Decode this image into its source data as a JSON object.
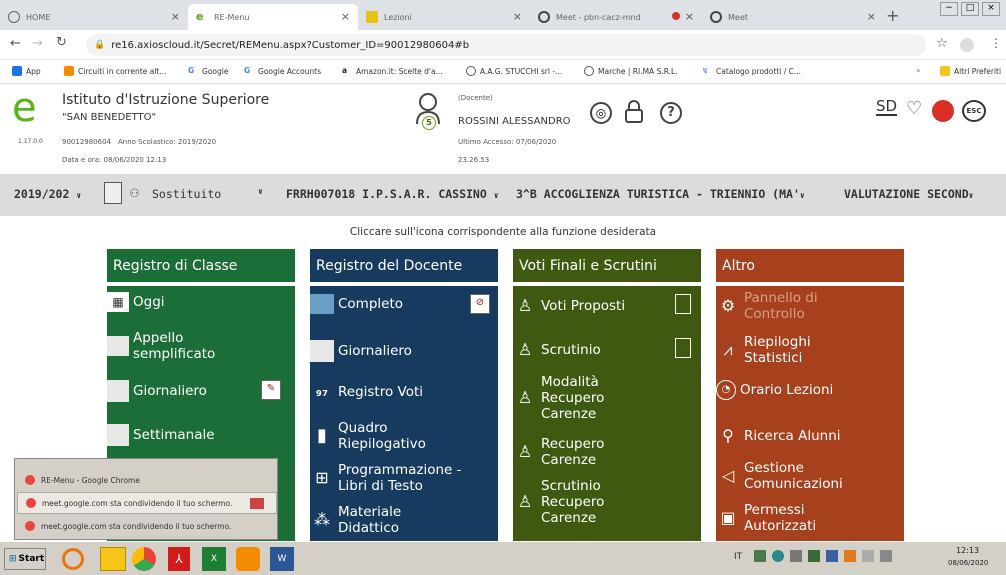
{
  "browser": {
    "tabs": [
      {
        "label": "HOME"
      },
      {
        "label": "RE-Menu"
      },
      {
        "label": "Lezioni"
      },
      {
        "label": "Meet - pbn-cacz-mnd"
      },
      {
        "label": "Meet"
      }
    ],
    "url": "re16.axioscloud.it/Secret/REMenu.aspx?Customer_ID=90012980604#b",
    "bookmarks": [
      {
        "label": "App"
      },
      {
        "label": "Circuiti in corrente alt..."
      },
      {
        "label": "Google"
      },
      {
        "label": "Google Accounts"
      },
      {
        "label": "Amazon.it: Scelte d'a..."
      },
      {
        "label": "A.A.G. STUCCHI srl -..."
      },
      {
        "label": "Marche | RI.MA S.R.L."
      },
      {
        "label": "Catalogo prodotti / C..."
      },
      {
        "label": "Altri Preferiti"
      }
    ],
    "more_bookmarks": "»"
  },
  "header": {
    "school_line1": "Istituto d'Istruzione Superiore",
    "school_line2": "\"SAN BENEDETTO\"",
    "version": "1.17.0.0",
    "code": "90012980604",
    "anno": "Anno Scolastico: 2019/2020",
    "datetime": "Data e ora: 08/06/2020 12:13",
    "user_badge": "5",
    "user_role": "(Docente)",
    "user_name": "ROSSINI ALESSANDRO",
    "last_access": "Ultimo Accesso: 07/06/2020",
    "last_time": "23.26.53",
    "esc_label": "ESC",
    "sd_label": "SD"
  },
  "selector": {
    "year": "2019/202",
    "substitute": "Sostituito",
    "school": "FRRH007018 I.P.S.A.R. CASSINO",
    "klass": "3^B ACCOGLIENZA TURISTICA - TRIENNIO (MA'",
    "eval": "VALUTAZIONE SECOND"
  },
  "hint": "Cliccare sull'icona corrispondente alla funzione desiderata",
  "columns": [
    {
      "title": "Registro di Classe",
      "items": [
        "Oggi",
        "Appello semplificato",
        "Giornaliero",
        "Settimanale"
      ]
    },
    {
      "title": "Registro del Docente",
      "items": [
        "Completo",
        "Giornaliero",
        "Registro Voti",
        "Quadro Riepilogativo",
        "Programmazione - Libri di Testo",
        "Materiale Didattico"
      ]
    },
    {
      "title": "Voti Finali e Scrutini",
      "items": [
        "Voti Proposti",
        "Scrutinio",
        "Modalità Recupero Carenze",
        "Recupero Carenze",
        "Scrutinio Recupero Carenze"
      ]
    },
    {
      "title": "Altro",
      "items": [
        "Pannello di Controllo",
        "Riepiloghi Statistici",
        "Orario Lezioni",
        "Ricerca Alunni",
        "Gestione Comunicazioni",
        "Permessi Autorizzati"
      ]
    }
  ],
  "colors": {
    "green": "#1c6e38",
    "blue": "#173b5e",
    "olive": "#3f5a10",
    "rust": "#a6401d"
  },
  "popup": {
    "title": "RE-Menu - Google Chrome",
    "row1": "meet.google.com sta condividendo il tuo schermo.",
    "row2": "meet.google.com sta condividendo il tuo schermo."
  },
  "taskbar": {
    "start": "Start",
    "lang": "IT",
    "time": "12:13",
    "date": "08/06/2020"
  }
}
